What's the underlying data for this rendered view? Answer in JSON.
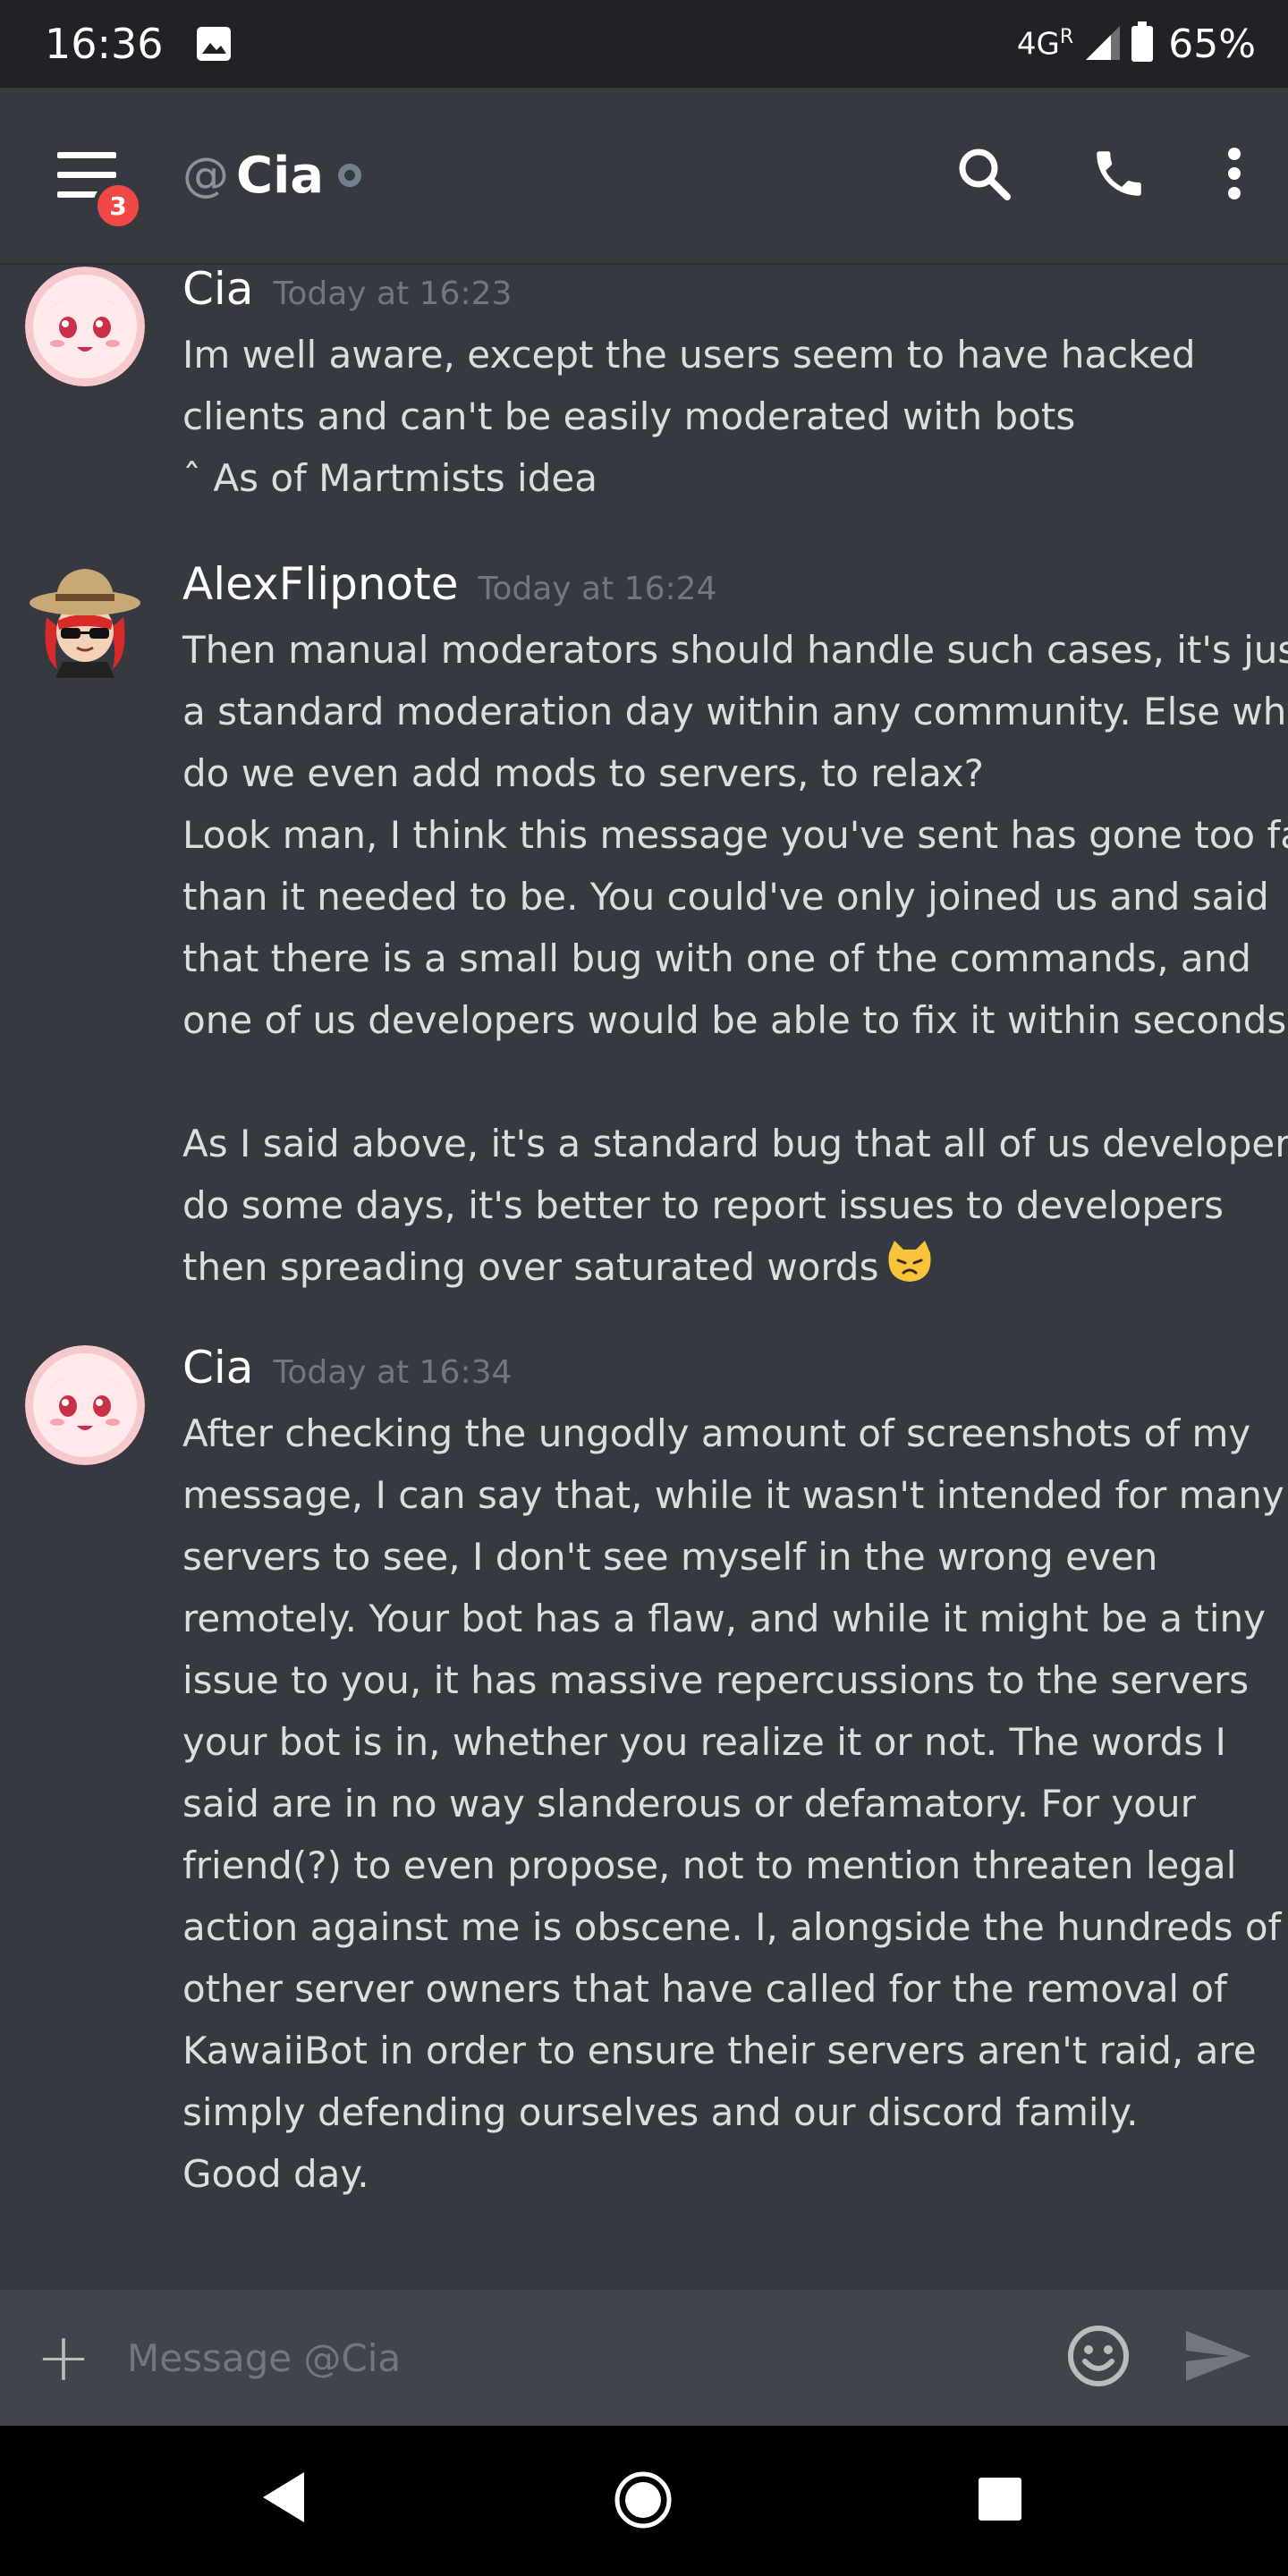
{
  "status_bar": {
    "time": "16:36",
    "network": "4G",
    "roaming": "R",
    "battery": "65%"
  },
  "header": {
    "at_symbol": "@",
    "channel_name": "Cia",
    "unread_badge": "3",
    "icons": [
      "menu-icon",
      "search-icon",
      "phone-icon",
      "more-vertical-icon"
    ]
  },
  "messages": [
    {
      "author": "Cia",
      "timestamp": "Today at 16:23",
      "lines": [
        "Im well aware, except the users seem to have hacked",
        "clients and can't be easily moderated with bots",
        "ˆ As of Martmists idea"
      ]
    },
    {
      "author": "AlexFlipnote",
      "timestamp": "Today at 16:24",
      "lines": [
        "Then manual moderators should handle such cases, it's just",
        "a standard moderation day within any community. Else why",
        "do we even add mods to servers, to relax?",
        "Look man, I think this message you've sent has gone too far",
        "than it needed to be. You could've only joined us and said",
        "that there is a small bug with one of the commands, and",
        "one of us developers would be able to fix it within seconds.",
        "",
        "As I said above, it's a standard bug that all of us developers",
        "do some days, it's better to report issues to developers",
        "then spreading over saturated words"
      ]
    },
    {
      "author": "Cia",
      "timestamp": "Today at 16:34",
      "lines": [
        "After checking the ungodly amount of screenshots of my",
        "message, I can say that, while it wasn't intended for many",
        "servers to see, I don't see myself in the wrong even",
        "remotely. Your bot has a flaw, and while it might be a tiny",
        "issue to you, it has massive repercussions to the servers",
        "your bot is in, whether you realize it or not. The words I",
        "said are in no way slanderous or defamatory. For your",
        "friend(?) to even propose, not to mention threaten legal",
        "action against me is obscene. I, alongside the hundreds of",
        "other server owners that have called for the removal of",
        "KawaiiBot in order to ensure their servers aren't raid, are",
        "simply defending ourselves and our discord family.",
        "Good day."
      ]
    }
  ],
  "composer": {
    "plus": "+",
    "placeholder": "Message @Cia"
  },
  "colors": {
    "background": "#36393f",
    "status_bar": "#202225",
    "composer": "#40444b",
    "badge": "#f04747",
    "timestamp": "#72767d",
    "text": "#dcddde"
  }
}
